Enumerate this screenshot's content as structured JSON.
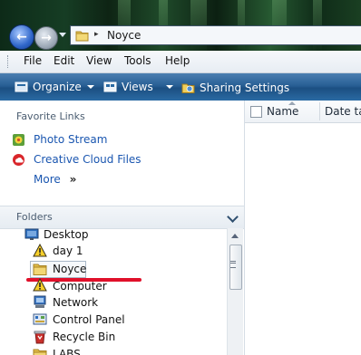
{
  "address": {
    "path": "Noyce",
    "separator": "▸"
  },
  "menu": [
    "File",
    "Edit",
    "View",
    "Tools",
    "Help"
  ],
  "commands": {
    "organize": "Organize",
    "views": "Views",
    "sharing": "Sharing Settings"
  },
  "nav": {
    "favorites_title": "Favorite Links",
    "favorites": [
      {
        "label": "Photo Stream",
        "icon": "photo-stream-icon"
      },
      {
        "label": "Creative Cloud Files",
        "icon": "creative-cloud-icon"
      }
    ],
    "more": "More",
    "more_glyph": "»",
    "folders_title": "Folders",
    "tree": [
      {
        "label": "Desktop",
        "icon": "desktop-icon"
      },
      {
        "label": "day 1",
        "icon": "warning-icon"
      },
      {
        "label": "Noyce",
        "icon": "folder-icon",
        "selected": true
      },
      {
        "label": "Computer",
        "icon": "warning-icon"
      },
      {
        "label": "Network",
        "icon": "network-icon"
      },
      {
        "label": "Control Panel",
        "icon": "control-panel-icon"
      },
      {
        "label": "Recycle Bin",
        "icon": "recycle-bin-icon"
      },
      {
        "label": "LABS",
        "icon": "folder-icon"
      }
    ]
  },
  "content": {
    "col_name": "Name",
    "col_date": "Date ta"
  },
  "colors": {
    "accent_red": "#e0102a",
    "link_blue": "#1a56b0",
    "command_bar": "#285f95"
  }
}
